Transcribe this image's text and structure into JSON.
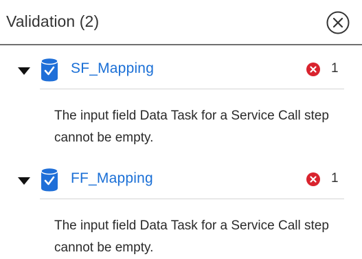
{
  "header": {
    "title": "Validation (2)",
    "close_icon": "close-circle-icon"
  },
  "items": [
    {
      "name": "SF_Mapping",
      "icon": "mapping-database-icon",
      "error_icon": "error-x-icon",
      "error_count": "1",
      "expanded": true,
      "message": "The input field Data Task for a Service Call step cannot be empty."
    },
    {
      "name": "FF_Mapping",
      "icon": "mapping-database-icon",
      "error_icon": "error-x-icon",
      "error_count": "1",
      "expanded": true,
      "message": "The input field Data Task for a Service Call step cannot be empty."
    }
  ],
  "colors": {
    "link": "#1a6fd6",
    "error": "#d9232e",
    "icon_blue": "#1f6fd8"
  }
}
